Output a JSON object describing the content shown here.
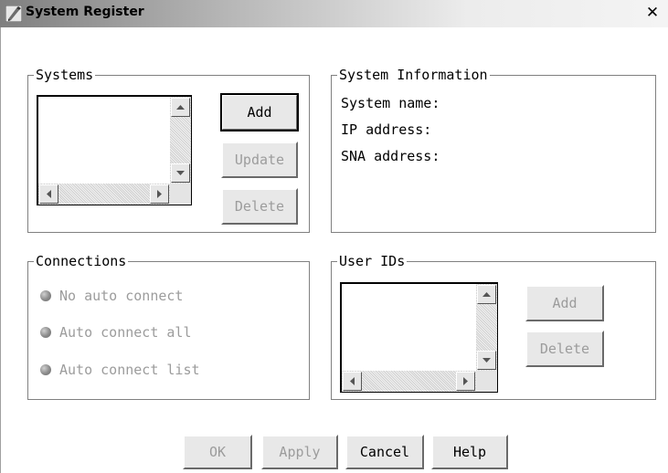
{
  "window": {
    "title": "System Register",
    "close_glyph": "✕",
    "icon": "pen-app-icon"
  },
  "systems": {
    "legend": "Systems",
    "add_label": "Add",
    "update_label": "Update",
    "delete_label": "Delete"
  },
  "system_info": {
    "legend": "System Information",
    "name_label": "System name:",
    "ip_label": "IP address:",
    "sna_label": "SNA address:"
  },
  "connections": {
    "legend": "Connections",
    "options": [
      "No auto connect",
      "Auto connect all",
      "Auto connect list"
    ]
  },
  "user_ids": {
    "legend": "User IDs",
    "add_label": "Add",
    "delete_label": "Delete"
  },
  "footer": {
    "ok_label": "OK",
    "apply_label": "Apply",
    "cancel_label": "Cancel",
    "help_label": "Help"
  },
  "colors": {
    "disabled_text": "#9c9c9c",
    "title_gradient_start": "#7f7f7f"
  }
}
